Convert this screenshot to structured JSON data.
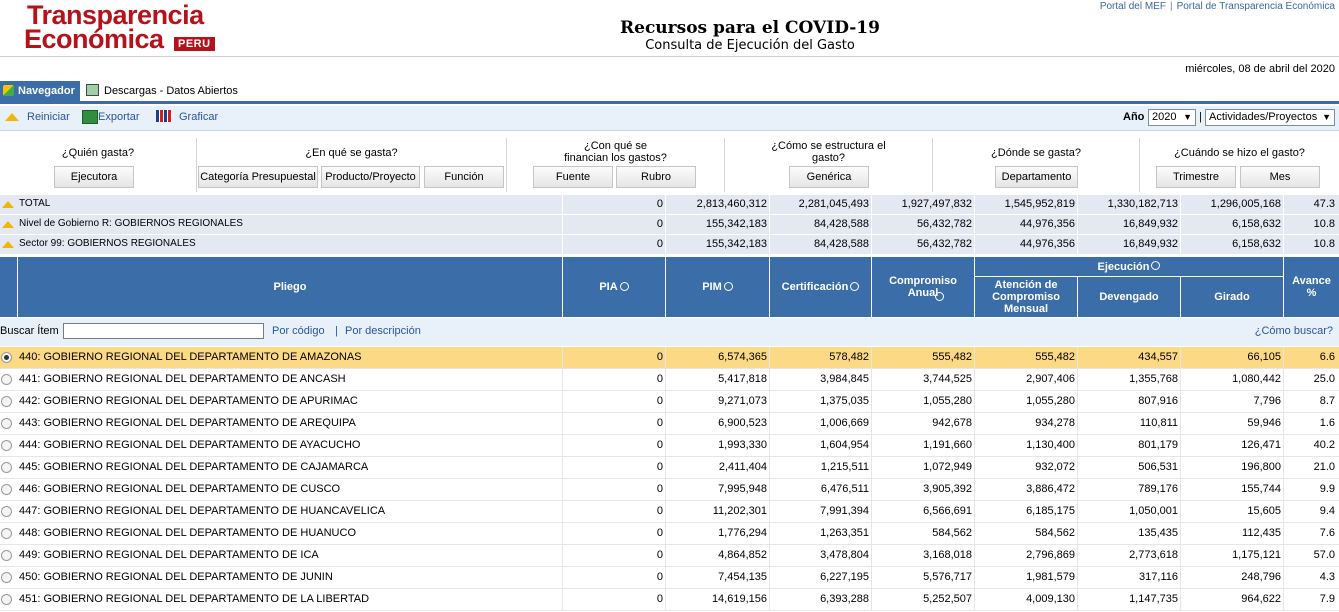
{
  "logo": {
    "line1": "Transparencia",
    "line2": "Económica",
    "badge": "PERU"
  },
  "top_links": {
    "mef": "Portal del MEF",
    "sep": "|",
    "transparencia": "Portal de Transparencia Económica"
  },
  "header": {
    "title": "Recursos para el COVID-19",
    "subtitle": "Consulta de Ejecución del Gasto",
    "date": "miércoles, 08 de abril del 2020"
  },
  "tabs": [
    {
      "label": "Navegador",
      "active": true
    },
    {
      "label": "Descargas - Datos Abiertos",
      "active": false
    }
  ],
  "toolbar": {
    "reiniciar": "Reiniciar",
    "exportar": "Exportar",
    "graficar": "Graficar",
    "anio_label": "Año",
    "anio_value": "2020",
    "pipe": "|",
    "nivel_value": "Actividades/Proyectos"
  },
  "questions": [
    {
      "q": "¿Quién gasta?",
      "buttons": [
        "Ejecutora"
      ]
    },
    {
      "q": "¿En qué se gasta?",
      "buttons": [
        "Categoría Presupuestal",
        "Producto/Proyecto",
        "Función"
      ]
    },
    {
      "q": "¿Con qué se financian los gastos?",
      "buttons": [
        "Fuente",
        "Rubro"
      ]
    },
    {
      "q": "¿Cómo se estructura el gasto?",
      "buttons": [
        "Genérica"
      ]
    },
    {
      "q": "¿Dónde se gasta?",
      "buttons": [
        "Departamento"
      ]
    },
    {
      "q": "¿Cuándo se hizo el gasto?",
      "buttons": [
        "Trimestre",
        "Mes"
      ]
    }
  ],
  "summary": [
    {
      "label": "TOTAL",
      "pia": "0",
      "pim": "2,813,460,312",
      "cert": "2,281,045,493",
      "comp": "1,927,497,832",
      "aten": "1,545,952,819",
      "dev": "1,330,182,713",
      "gir": "1,296,005,168",
      "av": "47.3"
    },
    {
      "label": "Nivel de Gobierno R: GOBIERNOS REGIONALES",
      "pia": "0",
      "pim": "155,342,183",
      "cert": "84,428,588",
      "comp": "56,432,782",
      "aten": "44,976,356",
      "dev": "16,849,932",
      "gir": "6,158,632",
      "av": "10.8"
    },
    {
      "label": "Sector 99: GOBIERNOS REGIONALES",
      "pia": "0",
      "pim": "155,342,183",
      "cert": "84,428,588",
      "comp": "56,432,782",
      "aten": "44,976,356",
      "dev": "16,849,932",
      "gir": "6,158,632",
      "av": "10.8"
    }
  ],
  "grid_header": {
    "pliego": "Pliego",
    "pia": "PIA",
    "pim": "PIM",
    "cert": "Certificación",
    "comp": "Compromiso Anual",
    "ejecucion": "Ejecución",
    "aten": "Atención de Compromiso Mensual",
    "dev": "Devengado",
    "gir": "Girado",
    "av": "Avance %"
  },
  "search": {
    "label": "Buscar Ítem",
    "value": "",
    "por_codigo": "Por código",
    "sep": "|",
    "por_descripcion": "Por descripción",
    "como_buscar": "¿Cómo buscar?"
  },
  "rows": [
    {
      "name": "440: GOBIERNO REGIONAL DEL DEPARTAMENTO DE AMAZONAS",
      "pia": "0",
      "pim": "6,574,365",
      "cert": "578,482",
      "comp": "555,482",
      "aten": "555,482",
      "dev": "434,557",
      "gir": "66,105",
      "av": "6.6"
    },
    {
      "name": "441: GOBIERNO REGIONAL DEL DEPARTAMENTO DE ANCASH",
      "pia": "0",
      "pim": "5,417,818",
      "cert": "3,984,845",
      "comp": "3,744,525",
      "aten": "2,907,406",
      "dev": "1,355,768",
      "gir": "1,080,442",
      "av": "25.0"
    },
    {
      "name": "442: GOBIERNO REGIONAL DEL DEPARTAMENTO DE APURIMAC",
      "pia": "0",
      "pim": "9,271,073",
      "cert": "1,375,035",
      "comp": "1,055,280",
      "aten": "1,055,280",
      "dev": "807,916",
      "gir": "7,796",
      "av": "8.7"
    },
    {
      "name": "443: GOBIERNO REGIONAL DEL DEPARTAMENTO DE AREQUIPA",
      "pia": "0",
      "pim": "6,900,523",
      "cert": "1,006,669",
      "comp": "942,678",
      "aten": "934,278",
      "dev": "110,811",
      "gir": "59,946",
      "av": "1.6"
    },
    {
      "name": "444: GOBIERNO REGIONAL DEL DEPARTAMENTO DE AYACUCHO",
      "pia": "0",
      "pim": "1,993,330",
      "cert": "1,604,954",
      "comp": "1,191,660",
      "aten": "1,130,400",
      "dev": "801,179",
      "gir": "126,471",
      "av": "40.2"
    },
    {
      "name": "445: GOBIERNO REGIONAL DEL DEPARTAMENTO DE CAJAMARCA",
      "pia": "0",
      "pim": "2,411,404",
      "cert": "1,215,511",
      "comp": "1,072,949",
      "aten": "932,072",
      "dev": "506,531",
      "gir": "196,800",
      "av": "21.0"
    },
    {
      "name": "446: GOBIERNO REGIONAL DEL DEPARTAMENTO DE CUSCO",
      "pia": "0",
      "pim": "7,995,948",
      "cert": "6,476,511",
      "comp": "3,905,392",
      "aten": "3,886,472",
      "dev": "789,176",
      "gir": "155,744",
      "av": "9.9"
    },
    {
      "name": "447: GOBIERNO REGIONAL DEL DEPARTAMENTO DE HUANCAVELICA",
      "pia": "0",
      "pim": "11,202,301",
      "cert": "7,991,394",
      "comp": "6,566,691",
      "aten": "6,185,175",
      "dev": "1,050,001",
      "gir": "15,605",
      "av": "9.4"
    },
    {
      "name": "448: GOBIERNO REGIONAL DEL DEPARTAMENTO DE HUANUCO",
      "pia": "0",
      "pim": "1,776,294",
      "cert": "1,263,351",
      "comp": "584,562",
      "aten": "584,562",
      "dev": "135,435",
      "gir": "112,435",
      "av": "7.6"
    },
    {
      "name": "449: GOBIERNO REGIONAL DEL DEPARTAMENTO DE ICA",
      "pia": "0",
      "pim": "4,864,852",
      "cert": "3,478,804",
      "comp": "3,168,018",
      "aten": "2,796,869",
      "dev": "2,773,618",
      "gir": "1,175,121",
      "av": "57.0"
    },
    {
      "name": "450: GOBIERNO REGIONAL DEL DEPARTAMENTO DE JUNIN",
      "pia": "0",
      "pim": "7,454,135",
      "cert": "6,227,195",
      "comp": "5,576,717",
      "aten": "1,981,579",
      "dev": "317,116",
      "gir": "248,796",
      "av": "4.3"
    },
    {
      "name": "451: GOBIERNO REGIONAL DEL DEPARTAMENTO DE LA LIBERTAD",
      "pia": "0",
      "pim": "14,619,156",
      "cert": "6,393,288",
      "comp": "5,252,507",
      "aten": "4,009,130",
      "dev": "1,147,735",
      "gir": "964,622",
      "av": "7.9"
    }
  ],
  "selected_row": 0,
  "colors": {
    "header_blue": "#3b6ea8",
    "selected_row": "#fcd984",
    "logo_red": "#b5121b",
    "summary_bg": "#e3e8f3"
  }
}
